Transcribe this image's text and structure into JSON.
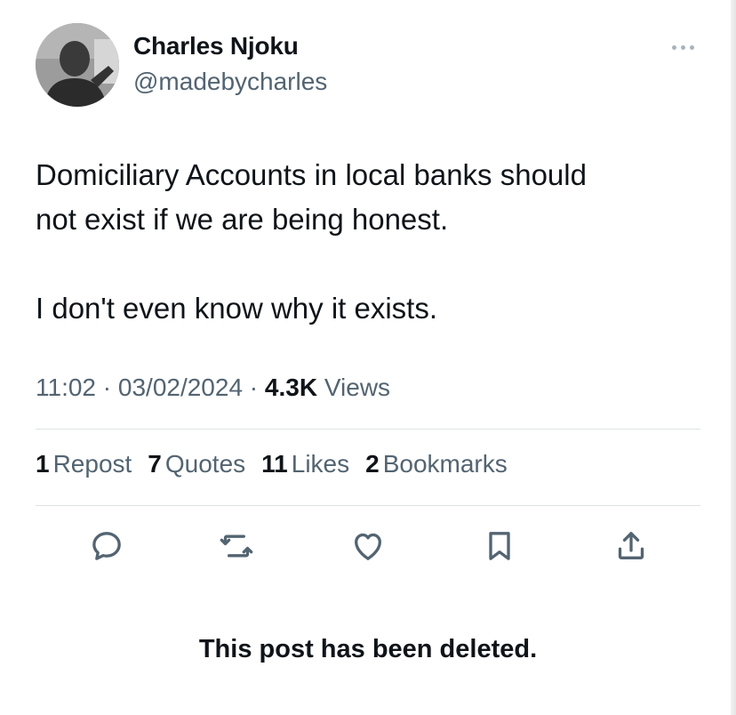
{
  "author": {
    "display_name": "Charles Njoku",
    "handle": "@madebycharles",
    "avatar_icon": "profile-photo"
  },
  "tweet": {
    "lines_para1": [
      "Domiciliary Accounts in local banks should",
      "not exist if we are being honest."
    ],
    "line_para2": "I don't even know why it exists."
  },
  "meta": {
    "time": "11:02",
    "sep1": " · ",
    "date": "03/02/2024",
    "sep2": " · ",
    "views_count": "4.3K",
    "views_label": " Views"
  },
  "stats": {
    "reposts": {
      "count": "1",
      "label": "Repost"
    },
    "quotes": {
      "count": "7",
      "label": "Quotes"
    },
    "likes": {
      "count": "11",
      "label": "Likes"
    },
    "bookmarks": {
      "count": "2",
      "label": "Bookmarks"
    }
  },
  "actions": [
    "reply-icon",
    "repost-icon",
    "like-icon",
    "bookmark-icon",
    "share-icon"
  ],
  "notice": "This post has been deleted.",
  "colors": {
    "text_primary": "#0f1419",
    "text_secondary": "#536471",
    "divider": "#dfe3e6",
    "icon": "#536471",
    "more_dots": "#a8b4bd"
  }
}
